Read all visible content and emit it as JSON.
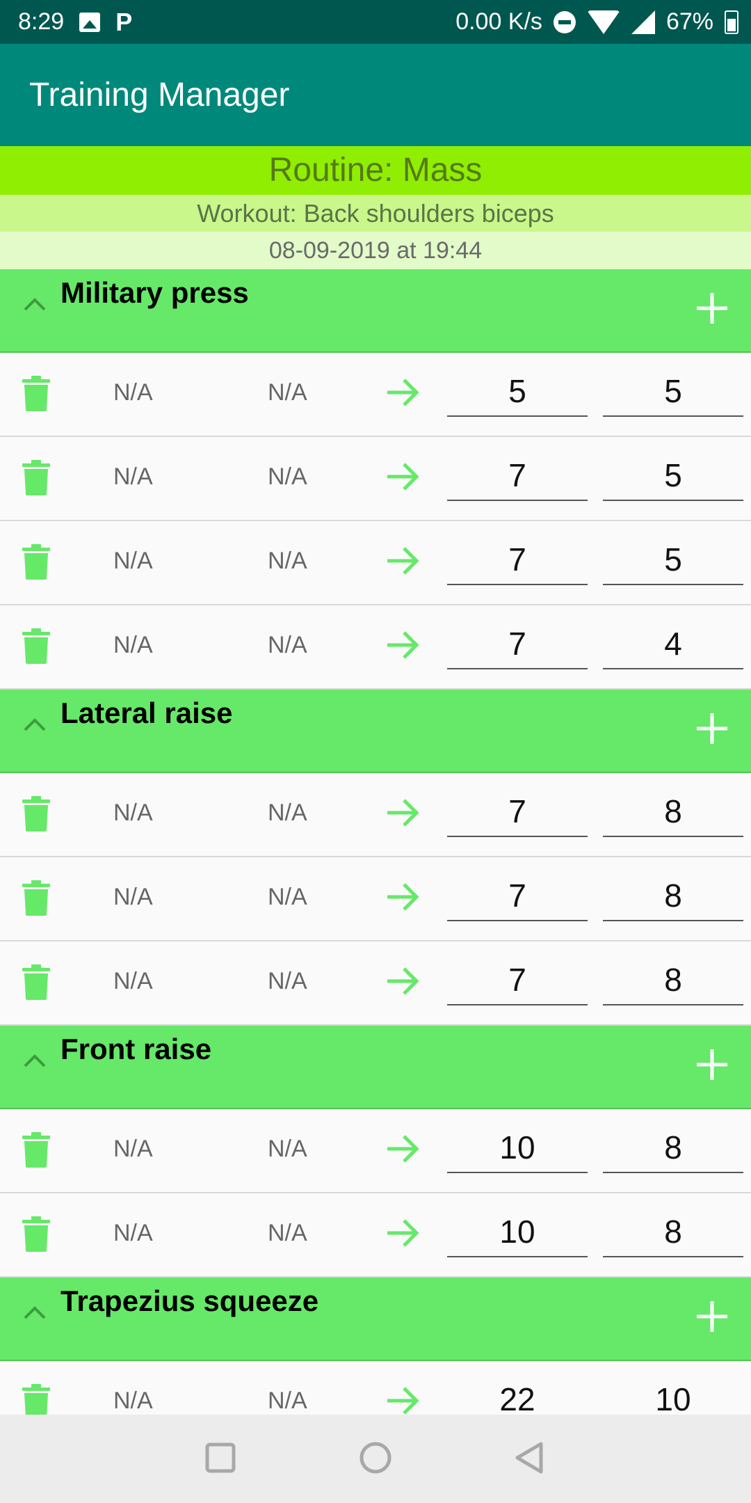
{
  "status_bar": {
    "time": "8:29",
    "speed": "0.00 K/s",
    "battery": "67%",
    "icons": [
      "image-icon",
      "p-icon",
      "dnd-icon",
      "wifi-icon",
      "signal-icon",
      "battery-icon"
    ]
  },
  "app_bar": {
    "title": "Training Manager"
  },
  "banner": {
    "routine": "Routine: Mass",
    "workout": "Workout: Back shoulders biceps",
    "datetime": "08-09-2019 at 19:44"
  },
  "colors": {
    "app_bar": "#00897b",
    "status_bar": "#00574f",
    "exercise_header": "#66e869",
    "routine_banner": "#90ee02",
    "icon_green": "#66e869"
  },
  "exercises": [
    {
      "name": "Military press",
      "sets": [
        {
          "prev_weight": "N/A",
          "prev_reps": "N/A",
          "weight": "5",
          "reps": "5"
        },
        {
          "prev_weight": "N/A",
          "prev_reps": "N/A",
          "weight": "7",
          "reps": "5"
        },
        {
          "prev_weight": "N/A",
          "prev_reps": "N/A",
          "weight": "7",
          "reps": "5"
        },
        {
          "prev_weight": "N/A",
          "prev_reps": "N/A",
          "weight": "7",
          "reps": "4"
        }
      ]
    },
    {
      "name": "Lateral raise",
      "sets": [
        {
          "prev_weight": "N/A",
          "prev_reps": "N/A",
          "weight": "7",
          "reps": "8"
        },
        {
          "prev_weight": "N/A",
          "prev_reps": "N/A",
          "weight": "7",
          "reps": "8"
        },
        {
          "prev_weight": "N/A",
          "prev_reps": "N/A",
          "weight": "7",
          "reps": "8"
        }
      ]
    },
    {
      "name": "Front raise",
      "sets": [
        {
          "prev_weight": "N/A",
          "prev_reps": "N/A",
          "weight": "10",
          "reps": "8"
        },
        {
          "prev_weight": "N/A",
          "prev_reps": "N/A",
          "weight": "10",
          "reps": "8"
        }
      ]
    },
    {
      "name": "Trapezius squeeze",
      "sets": [
        {
          "prev_weight": "N/A",
          "prev_reps": "N/A",
          "weight": "22",
          "reps": "10"
        }
      ]
    }
  ]
}
